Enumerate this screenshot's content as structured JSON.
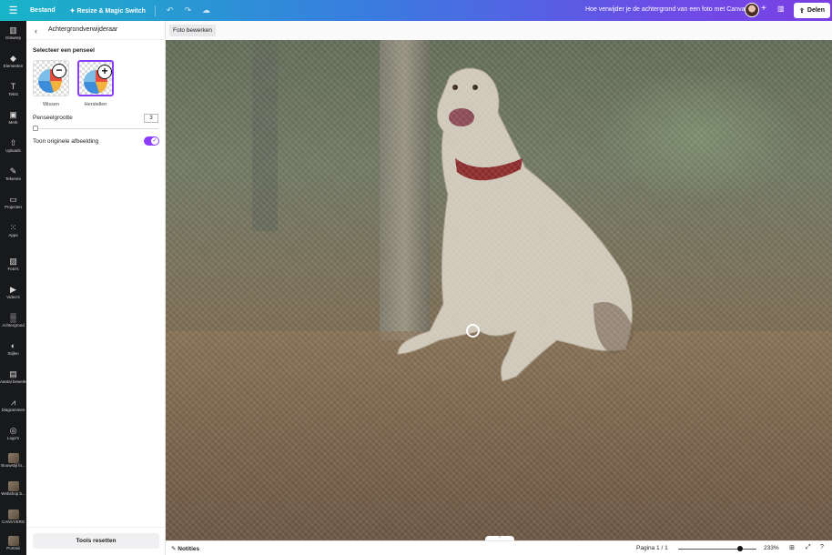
{
  "topbar": {
    "menu_icon": "menu-icon",
    "file": "Bestand",
    "resize": "Resize & Magic Switch",
    "undo_icon": "undo-icon",
    "redo_icon": "redo-icon",
    "cloud_icon": "cloud-check-icon",
    "doc_title": "Hoe verwijder je de achtergrond van een foto met Canva",
    "share": "Delen"
  },
  "rail": [
    {
      "label": "Ontwerp",
      "icon": "layout-icon",
      "glyph": "▥"
    },
    {
      "label": "Elementen",
      "icon": "elements-icon",
      "glyph": "◆"
    },
    {
      "label": "Tekst",
      "icon": "text-icon",
      "glyph": "T"
    },
    {
      "label": "Merk",
      "icon": "brand-icon",
      "glyph": "▣"
    },
    {
      "label": "Uploads",
      "icon": "upload-icon",
      "glyph": "⇧"
    },
    {
      "label": "Tekenen",
      "icon": "draw-icon",
      "glyph": "✎"
    },
    {
      "label": "Projecten",
      "icon": "folder-icon",
      "glyph": "▭"
    },
    {
      "label": "Apps",
      "icon": "apps-icon",
      "glyph": "⁙"
    },
    {
      "label": "Foto's",
      "icon": "photo-icon",
      "glyph": "▨"
    },
    {
      "label": "Video's",
      "icon": "video-icon",
      "glyph": "▶"
    },
    {
      "label": "Achtergrond",
      "icon": "background-icon",
      "glyph": "▒"
    },
    {
      "label": "Stijlen",
      "icon": "styles-icon",
      "glyph": "◐"
    },
    {
      "label": "Aantal bewerken",
      "icon": "bulk-create-icon",
      "glyph": "▤"
    },
    {
      "label": "Diagrammen",
      "icon": "chart-icon",
      "glyph": "⩘"
    },
    {
      "label": "Logo's",
      "icon": "logo-icon",
      "glyph": "◎"
    },
    {
      "label": "Bouwstijl fo...",
      "icon": "thumbnail",
      "glyph": ""
    },
    {
      "label": "Webshop b...",
      "icon": "thumbnail",
      "glyph": ""
    },
    {
      "label": "CANVVERS",
      "icon": "thumbnail",
      "glyph": ""
    },
    {
      "label": "Portrait",
      "icon": "thumbnail",
      "glyph": ""
    }
  ],
  "panel": {
    "back_icon": "chevron-left-icon",
    "title": "Achtergrondverwijderaar",
    "select_brush": "Selecteer een penseel",
    "brushes": [
      {
        "label": "Wissen",
        "badge": "−",
        "selected": false
      },
      {
        "label": "Herstellen",
        "badge": "+",
        "selected": true
      }
    ],
    "brush_size_label": "Penseelgrootte",
    "brush_size_value": "3",
    "show_original_label": "Toon originele afbeelding",
    "show_original_on": true,
    "reset_button": "Tools resetten"
  },
  "canvas": {
    "edit_photo": "Foto bewerken"
  },
  "bottombar": {
    "notes": "Notities",
    "page": "Pagina 1 / 1",
    "zoom": "233%",
    "zoom_fraction": 0.75
  },
  "colors": {
    "accent": "#8b3dff"
  }
}
